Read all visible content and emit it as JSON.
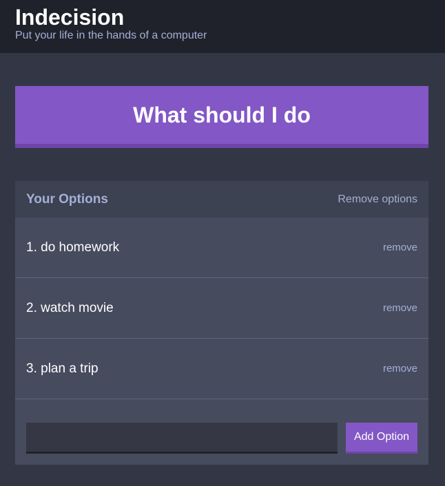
{
  "header": {
    "title": "Indecision",
    "subtitle": "Put your life in the hands of a computer"
  },
  "action": {
    "label": "What should I do"
  },
  "options_panel": {
    "title": "Your Options",
    "remove_all_label": "Remove options",
    "items": [
      {
        "text": "1. do homework",
        "remove_label": "remove"
      },
      {
        "text": "2. watch movie",
        "remove_label": "remove"
      },
      {
        "text": "3. plan a trip",
        "remove_label": "remove"
      }
    ]
  },
  "add_option": {
    "input_value": "",
    "button_label": "Add Option"
  },
  "colors": {
    "background": "#333745",
    "header": "#20222b",
    "accent": "#8357c5",
    "muted_text": "#a5afd7",
    "panel": "#464b5e"
  }
}
